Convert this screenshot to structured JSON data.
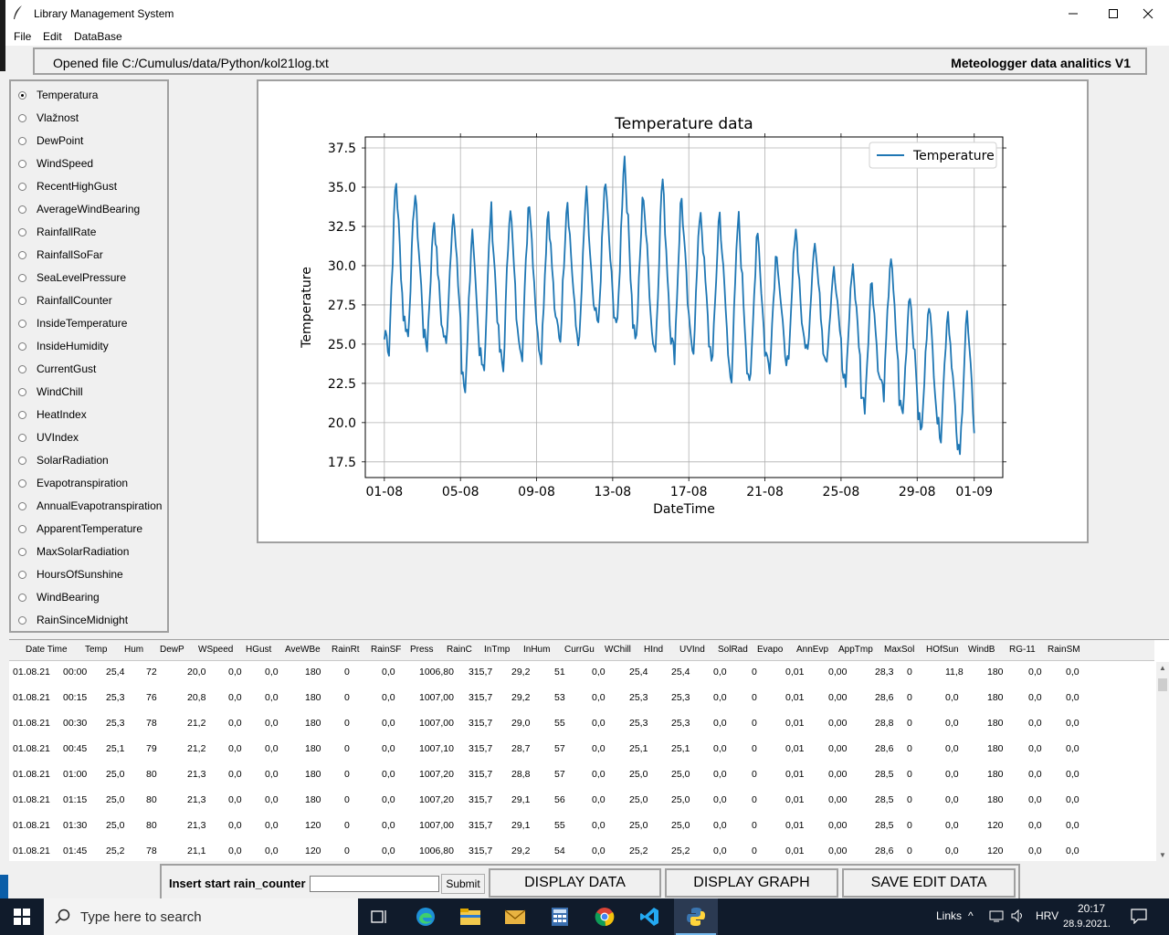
{
  "window": {
    "title": "Library Management System",
    "minimize": "—",
    "maximize": "☐",
    "close": "✕"
  },
  "menu": {
    "file": "File",
    "edit": "Edit",
    "database": "DataBase"
  },
  "header": {
    "opened_file": "Opened file C:/Cumulus/data/Python/kol21log.txt",
    "version": "Meteologger data analitics V1"
  },
  "radio_options": [
    "Temperatura",
    "Vlažnost",
    "DewPoint",
    "WindSpeed",
    "RecentHighGust",
    "AverageWindBearing",
    "RainfallRate",
    "RainfallSoFar",
    "SeaLevelPressure",
    "RainfallCounter",
    "InsideTemperature",
    "InsideHumidity",
    "CurrentGust",
    "WindChill",
    "HeatIndex",
    "UVIndex",
    "SolarRadiation",
    "Evapotranspiration",
    "AnnualEvapotranspiration",
    "ApparentTemperature",
    "MaxSolarRadiation",
    "HoursOfSunshine",
    "WindBearing",
    "RainSinceMidnight"
  ],
  "radio_selected": 0,
  "chart_data": {
    "type": "line",
    "title": "Temperature data",
    "xlabel": "DateTime",
    "ylabel": "Temperature",
    "x_ticks": [
      "01-08",
      "05-08",
      "09-08",
      "13-08",
      "17-08",
      "21-08",
      "25-08",
      "29-08",
      "01-09"
    ],
    "y_ticks": [
      "17.5",
      "20.0",
      "22.5",
      "25.0",
      "27.5",
      "30.0",
      "32.5",
      "35.0",
      "37.5"
    ],
    "ylim": [
      16.5,
      38.2
    ],
    "xlim_days": [
      -1.0,
      32.5
    ],
    "grid": true,
    "legend": "top-right",
    "series": [
      {
        "name": "Temperature",
        "color": "#1f77b4",
        "daily_min_max": [
          [
            24.6,
            35.9
          ],
          [
            25.5,
            35.0
          ],
          [
            24.8,
            33.3
          ],
          [
            24.9,
            33.8
          ],
          [
            22.0,
            32.5
          ],
          [
            23.5,
            34.0
          ],
          [
            23.3,
            34.5
          ],
          [
            24.5,
            34.8
          ],
          [
            24.3,
            34.0
          ],
          [
            25.3,
            34.7
          ],
          [
            25.0,
            35.0
          ],
          [
            26.0,
            35.8
          ],
          [
            26.0,
            37.5
          ],
          [
            25.3,
            35.0
          ],
          [
            24.5,
            36.0
          ],
          [
            24.3,
            34.8
          ],
          [
            24.7,
            34.0
          ],
          [
            24.0,
            33.8
          ],
          [
            23.0,
            33.5
          ],
          [
            22.5,
            33.0
          ],
          [
            23.5,
            31.3
          ],
          [
            23.5,
            33.0
          ],
          [
            24.5,
            32.0
          ],
          [
            24.0,
            30.0
          ],
          [
            22.5,
            30.5
          ],
          [
            21.0,
            29.5
          ],
          [
            21.8,
            31.0
          ],
          [
            20.5,
            28.7
          ],
          [
            19.5,
            28.2
          ],
          [
            19.2,
            27.5
          ],
          [
            17.8,
            27.3
          ],
          [
            18.5,
            28.5
          ],
          [
            19.8,
            23.0
          ]
        ],
        "start_value": 25.3,
        "end_value": 20.7
      }
    ]
  },
  "table": {
    "columns": [
      "Date Time",
      "Temp",
      "Hum",
      "DewP",
      "WSpeed",
      "HGust",
      "AveWBe",
      "RainRt",
      "RainSF",
      "Press",
      "RainC",
      "InTmp",
      "InHum",
      "CurrGu",
      "WChill",
      "HInd",
      "UVInd",
      "SolRad",
      "Evapo",
      "AnnEvp",
      "AppTmp",
      "MaxSol",
      "HOfSun",
      "WindB",
      "RG-11",
      "RainSM"
    ],
    "rows": [
      [
        "01.08.21",
        "00:00",
        "25,4",
        "72",
        "20,0",
        "0,0",
        "0,0",
        "180",
        "0",
        "0,0",
        "1006,80",
        "315,7",
        "29,2",
        "51",
        "0,0",
        "25,4",
        "25,4",
        "0,0",
        "0",
        "0,01",
        "0,00",
        "28,3",
        "0",
        "11,8",
        "180",
        "0,0",
        "0,0"
      ],
      [
        "01.08.21",
        "00:15",
        "25,3",
        "76",
        "20,8",
        "0,0",
        "0,0",
        "180",
        "0",
        "0,0",
        "1007,00",
        "315,7",
        "29,2",
        "53",
        "0,0",
        "25,3",
        "25,3",
        "0,0",
        "0",
        "0,01",
        "0,00",
        "28,6",
        "0",
        "0,0",
        "180",
        "0,0",
        "0,0"
      ],
      [
        "01.08.21",
        "00:30",
        "25,3",
        "78",
        "21,2",
        "0,0",
        "0,0",
        "180",
        "0",
        "0,0",
        "1007,00",
        "315,7",
        "29,0",
        "55",
        "0,0",
        "25,3",
        "25,3",
        "0,0",
        "0",
        "0,01",
        "0,00",
        "28,8",
        "0",
        "0,0",
        "180",
        "0,0",
        "0,0"
      ],
      [
        "01.08.21",
        "00:45",
        "25,1",
        "79",
        "21,2",
        "0,0",
        "0,0",
        "180",
        "0",
        "0,0",
        "1007,10",
        "315,7",
        "28,7",
        "57",
        "0,0",
        "25,1",
        "25,1",
        "0,0",
        "0",
        "0,01",
        "0,00",
        "28,6",
        "0",
        "0,0",
        "180",
        "0,0",
        "0,0"
      ],
      [
        "01.08.21",
        "01:00",
        "25,0",
        "80",
        "21,3",
        "0,0",
        "0,0",
        "180",
        "0",
        "0,0",
        "1007,20",
        "315,7",
        "28,8",
        "57",
        "0,0",
        "25,0",
        "25,0",
        "0,0",
        "0",
        "0,01",
        "0,00",
        "28,5",
        "0",
        "0,0",
        "180",
        "0,0",
        "0,0"
      ],
      [
        "01.08.21",
        "01:15",
        "25,0",
        "80",
        "21,3",
        "0,0",
        "0,0",
        "180",
        "0",
        "0,0",
        "1007,20",
        "315,7",
        "29,1",
        "56",
        "0,0",
        "25,0",
        "25,0",
        "0,0",
        "0",
        "0,01",
        "0,00",
        "28,5",
        "0",
        "0,0",
        "180",
        "0,0",
        "0,0"
      ],
      [
        "01.08.21",
        "01:30",
        "25,0",
        "80",
        "21,3",
        "0,0",
        "0,0",
        "120",
        "0",
        "0,0",
        "1007,00",
        "315,7",
        "29,1",
        "55",
        "0,0",
        "25,0",
        "25,0",
        "0,0",
        "0",
        "0,01",
        "0,00",
        "28,5",
        "0",
        "0,0",
        "120",
        "0,0",
        "0,0"
      ],
      [
        "01.08.21",
        "01:45",
        "25,2",
        "78",
        "21,1",
        "0,0",
        "0,0",
        "120",
        "0",
        "0,0",
        "1006,80",
        "315,7",
        "29,2",
        "54",
        "0,0",
        "25,2",
        "25,2",
        "0,0",
        "0",
        "0,01",
        "0,00",
        "28,6",
        "0",
        "0,0",
        "120",
        "0,0",
        "0,0"
      ]
    ]
  },
  "bottom": {
    "rain_label": "Insert start rain_counter",
    "rain_value": "",
    "submit": "Submit",
    "display_data": "DISPLAY DATA",
    "display_graph": "DISPLAY GRAPH",
    "save_edit": "SAVE EDIT DATA"
  },
  "taskbar": {
    "search_placeholder": "Type here to search",
    "links": "Links",
    "language": "HRV",
    "time": "20:17",
    "date": "28.9.2021."
  }
}
